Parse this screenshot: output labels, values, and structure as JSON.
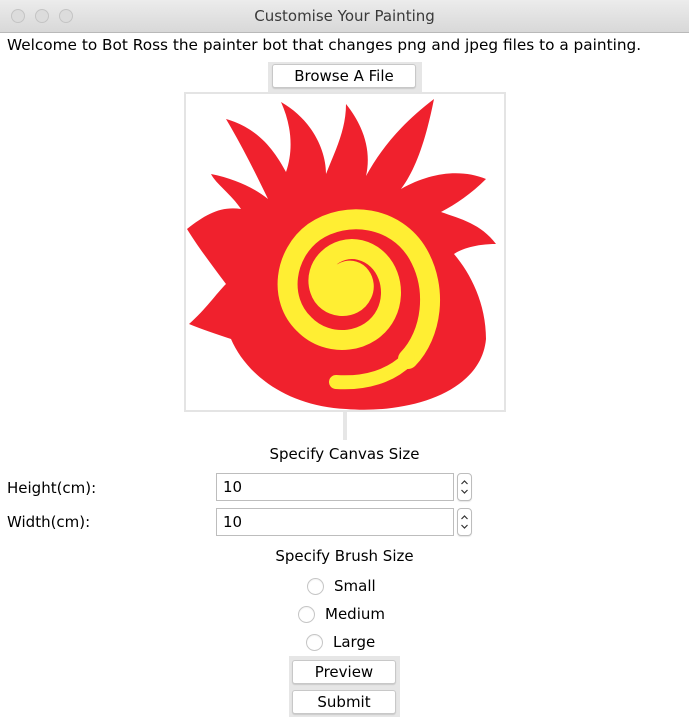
{
  "window": {
    "title": "Customise Your Painting",
    "controls": [
      "close",
      "minimize",
      "zoom"
    ]
  },
  "welcome_text": "Welcome to Bot Ross the painter bot that changes png and jpeg files to a painting.",
  "browse_button": "Browse A File",
  "preview_image": {
    "icon": "sun-spiral-image",
    "colors": {
      "flame": "#f0212d",
      "spiral": "#ffee33"
    }
  },
  "canvas": {
    "heading": "Specify Canvas Size",
    "height": {
      "label": "Height(cm):",
      "value": "10"
    },
    "width": {
      "label": "Width(cm):",
      "value": "10"
    }
  },
  "brush": {
    "heading": "Specify Brush Size",
    "options": [
      "Small",
      "Medium",
      "Large"
    ]
  },
  "buttons": {
    "preview": "Preview",
    "submit": "Submit"
  }
}
